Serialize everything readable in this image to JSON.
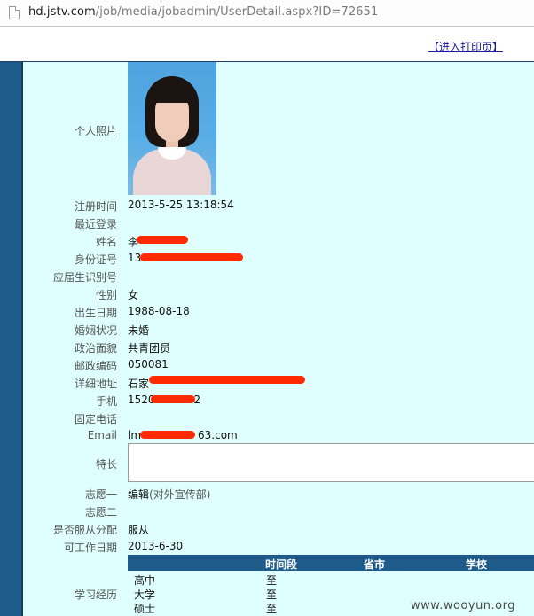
{
  "browser": {
    "url_host": "hd.jstv.com",
    "url_path": "/job/media/jobadmin/UserDetail.aspx?ID=72651"
  },
  "header": {
    "print_link": "【进入打印页】"
  },
  "fields": {
    "photo_label": "个人照片",
    "register_time_label": "注册时间",
    "register_time": "2013-5-25 13:18:54",
    "last_login_label": "最近登录",
    "last_login": "",
    "name_label": "姓名",
    "name": "李",
    "id_number_label": "身份证号",
    "id_number": "13",
    "grad_id_label": "应届生识别号",
    "grad_id": "",
    "gender_label": "性别",
    "gender": "女",
    "birth_date_label": "出生日期",
    "birth_date": "1988-08-18",
    "marital_label": "婚姻状况",
    "marital": "未婚",
    "political_label": "政治面貌",
    "political": "共青团员",
    "postal_label": "邮政编码",
    "postal": "050081",
    "address_label": "详细地址",
    "address": "石家",
    "mobile_label": "手机",
    "mobile_prefix": "1520",
    "mobile_suffix": "2",
    "phone_label": "固定电话",
    "phone": "",
    "email_label": "Email",
    "email_prefix": "lm",
    "email_suffix": "63.com",
    "specialty_label": "特长",
    "specialty": "",
    "choice1_label": "志愿一",
    "choice1": "编辑",
    "choice1_dept": "(对外宣传部)",
    "choice2_label": "志愿二",
    "choice2": "",
    "obey_label": "是否服从分配",
    "obey": "服从",
    "available_label": "可工作日期",
    "available": "2013-6-30",
    "study_label": "学习经历"
  },
  "study": {
    "headers": [
      "",
      "时间段",
      "省市",
      "学校"
    ],
    "rows": [
      {
        "degree": "高中",
        "to": "至"
      },
      {
        "degree": "大学",
        "to": "至"
      },
      {
        "degree": "硕士",
        "to": "至"
      }
    ]
  },
  "watermark": "www.wooyun.org",
  "colors": {
    "content_bg": "#dffffe",
    "left_bar": "#1e5a8a",
    "redaction": "#ff2a00"
  }
}
